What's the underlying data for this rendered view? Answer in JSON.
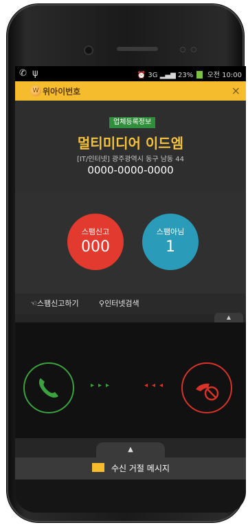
{
  "status_bar": {
    "time": "오전 10:00",
    "network": "3G",
    "battery_percent": "23%"
  },
  "app_bar": {
    "title": "위아이번호",
    "close_symbol": "×",
    "logo_text": "W"
  },
  "caller_info": {
    "badge": "업체등록정보",
    "company_name": "멀티미디어 이드엠",
    "address": "[IT/인터넷] 광주광역시 동구 남동 44",
    "phone_number": "0000-0000-0000"
  },
  "stats": {
    "spam_report_label": "스팸신고",
    "spam_report_count": "000",
    "not_spam_label": "스팸아님",
    "not_spam_count": "1"
  },
  "links": {
    "report_spam": "스팸신고하기",
    "internet_search": "인터넷검색"
  },
  "call_actions": {
    "accept_arrows": "▸▸▸",
    "decline_arrows": "◂◂◂"
  },
  "bottom": {
    "up_symbol": "▲",
    "reject_message": "수신 거절 메시지"
  },
  "colors": {
    "accent_yellow": "#f5bd2e",
    "accept_green": "#3aa33f",
    "decline_red": "#e23a2f",
    "not_spam_blue": "#2a9bb8"
  }
}
